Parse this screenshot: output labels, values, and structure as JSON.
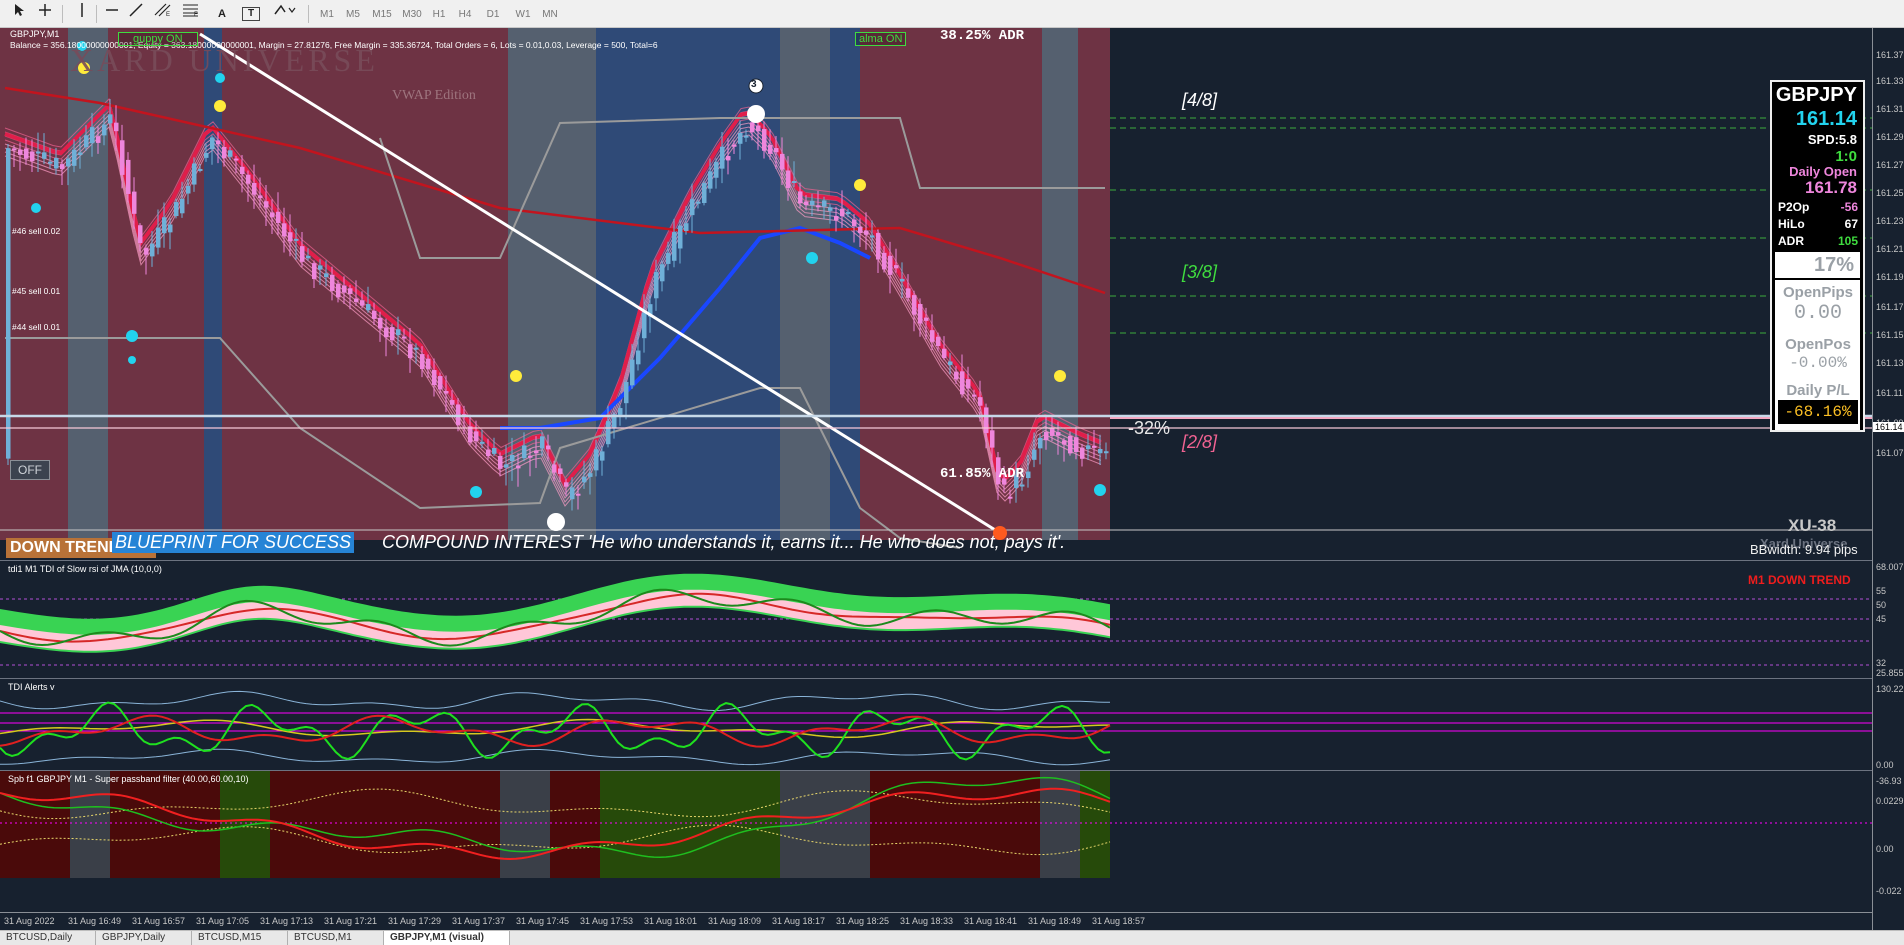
{
  "toolbar": {
    "timeframes": [
      "M1",
      "M5",
      "M15",
      "M30",
      "H1",
      "H4",
      "D1",
      "W1",
      "MN"
    ],
    "tools": [
      "cursor-icon",
      "crosshair-icon",
      "vertical-line-icon",
      "horizontal-line-icon",
      "trendline-icon",
      "equidistant-channel-icon",
      "fibonacci-icon",
      "text-icon",
      "text-label-icon",
      "arrows-icon"
    ],
    "text_tool_label": "A",
    "label_tool_label": "T"
  },
  "main": {
    "symbol_header": "GBPJPY,M1",
    "account_line": "Balance = 356.18000000000001, Equity = 363.18000000000001, Margin = 27.81276, Free Margin = 335.36724, Total Orders = 6, Lots = 0.01,0.03, Leverage = 500, Total=6",
    "guppy_badge": "guppy ON",
    "alma_badge": "alma ON",
    "watermark_title": "XARD UNIVERSE",
    "watermark_sub": "VWAP Edition",
    "adr_top": "38.25% ADR",
    "adr_mid": "61.85% ADR",
    "fib_48": "[4/8]",
    "fib_38": "[3/8]",
    "fib_28": "[2/8]",
    "pct_label": "-32%",
    "orders": [
      "#46 sell 0.02",
      "#45 sell 0.01",
      "#44 sell 0.01"
    ],
    "off_button": "OFF",
    "trend_label": "DOWN TREND",
    "ticker_blue": "BLUEPRINT FOR SUCCESS",
    "ticker_text": "COMPOUND INTEREST  'He who understands it, earns it... He who does not, pays it'.",
    "right_xu": "XU-38",
    "right_xu_sub": "Xard Universe",
    "bbwidth": "BBwidth: 9.94 pips",
    "markers": [
      "3",
      "1"
    ]
  },
  "info_box": {
    "pair": "GBPJPY",
    "price": "161.14",
    "spread": "SPD:5.8",
    "ratio": "1:0",
    "daily_open_label": "Daily Open",
    "daily_open": "161.78",
    "p2op_label": "P2Op",
    "p2op": "-56",
    "hilo_label": "HiLo",
    "hilo": "67",
    "adr_label": "ADR",
    "adr": "105",
    "percent": "17%",
    "open_pips_label": "OpenPips",
    "open_pips": "0.00",
    "open_pos_label": "OpenPos",
    "open_pos": "-0.00%",
    "daily_pl_label": "Daily P/L",
    "daily_pl": "-68.16%"
  },
  "tdi": {
    "label": "tdi1 M1 TDI of Slow rsi of JMA (10,0,0)",
    "trend_text": "M1 DOWN TREND",
    "levels": [
      "68.007",
      "55",
      "50",
      "45",
      "32",
      "25.855"
    ]
  },
  "alerts": {
    "label": "TDI Alerts v",
    "levels": [
      "130.22",
      "0.00",
      "-36.93"
    ]
  },
  "spb": {
    "label": "Spb f1 GBPJPY M1 - Super passband filter (40.00,60.00,10)",
    "levels": [
      "0.0229",
      "0.00",
      "-0.022"
    ]
  },
  "price_axis": [
    "161.37",
    "161.33",
    "161.31",
    "161.29",
    "161.27",
    "161.25",
    "161.23",
    "161.21",
    "161.19",
    "161.17",
    "161.15",
    "161.13",
    "161.11",
    "161.09",
    "161.07"
  ],
  "current_price": "161.14",
  "time_axis": [
    "31 Aug 2022",
    "31 Aug 16:49",
    "31 Aug 16:57",
    "31 Aug 17:05",
    "31 Aug 17:13",
    "31 Aug 17:21",
    "31 Aug 17:29",
    "31 Aug 17:37",
    "31 Aug 17:45",
    "31 Aug 17:53",
    "31 Aug 18:01",
    "31 Aug 18:09",
    "31 Aug 18:17",
    "31 Aug 18:25",
    "31 Aug 18:33",
    "31 Aug 18:41",
    "31 Aug 18:49",
    "31 Aug 18:57"
  ],
  "tabs": [
    "BTCUSD,Daily",
    "GBPJPY,Daily",
    "BTCUSD,M15",
    "BTCUSD,M1",
    "GBPJPY,M1 (visual)"
  ],
  "colors": {
    "bull_candle": "#6fb0d8",
    "bear_candle": "#ee86dc",
    "session_red": "#6e3344",
    "session_blue": "#2f4a77",
    "session_gray": "#55606f",
    "accent_green": "#3fdc3f",
    "accent_cyan": "#22d3ee"
  }
}
